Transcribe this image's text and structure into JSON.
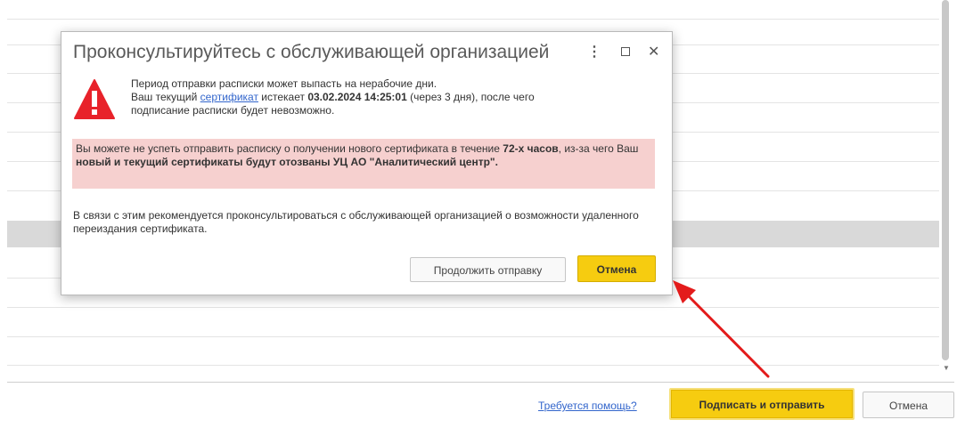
{
  "dialog": {
    "title": "Проконсультируйтесь с обслуживающей организацией",
    "controls": {
      "more": "⋮",
      "close": "✕"
    },
    "icon": "warning-triangle-icon",
    "line1": "Период отправки расписки может выпасть на нерабочие дни.",
    "line2_pre": "Ваш текущий ",
    "line2_link": "сертификат",
    "line2_mid": " истекает ",
    "line2_date": "03.02.2024 14:25:01",
    "line2_post": " (через 3 дня), после чего",
    "line3": "подписание расписки будет невозможно.",
    "alert": {
      "p1": "Вы можете не успеть отправить расписку о получении нового сертификата в течение ",
      "b1": "72-х часов",
      "p2": ", из-за чего Ваш ",
      "b2": "новый и текущий сертификаты будут отозваны УЦ АО \"Аналитический центр\"."
    },
    "recommend": "В связи с этим рекомендуется проконсультироваться с обслуживающей организацией о возможности удаленного переиздания сертификата.",
    "continue_label": "Продолжить отправку",
    "cancel_label": "Отмена"
  },
  "footer": {
    "help_link": "Требуется помощь?",
    "sign_label": "Подписать и отправить",
    "cancel_label": "Отмена"
  },
  "colors": {
    "accent_yellow": "#f6cc10",
    "alert_background": "#f6d0cf",
    "warning_red": "#e8222a",
    "link_blue": "#3366cc",
    "annotation_arrow": "#e31b1b"
  }
}
